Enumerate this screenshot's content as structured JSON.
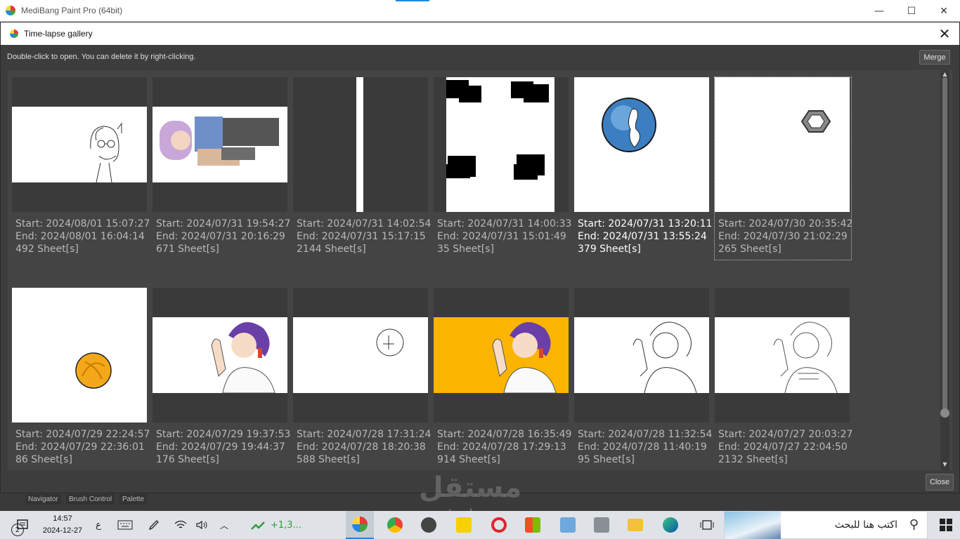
{
  "app": {
    "title": "MediBang Paint Pro (64bit)",
    "minimize_glyph": "—",
    "maximize_glyph": "☐",
    "close_glyph": "✕"
  },
  "dialog": {
    "title": "Time-lapse gallery",
    "close_glyph": "✕",
    "hint": "Double-click to open. You can delete it by right-clicking.",
    "merge_label": "Merge",
    "close_label": "Close"
  },
  "gallery": [
    {
      "start": "Start: 2024/08/01 15:07:27",
      "end": "End: 2024/08/01 16:04:14",
      "sheets": "492 Sheet[s]"
    },
    {
      "start": "Start: 2024/07/31 19:54:27",
      "end": "End: 2024/07/31 20:16:29",
      "sheets": "671 Sheet[s]"
    },
    {
      "start": "Start: 2024/07/31 14:02:54",
      "end": "End: 2024/07/31 15:17:15",
      "sheets": "2144 Sheet[s]"
    },
    {
      "start": "Start: 2024/07/31 14:00:33",
      "end": "End: 2024/07/31 15:01:49",
      "sheets": "35 Sheet[s]"
    },
    {
      "start": "Start: 2024/07/31 13:20:11",
      "end": "End: 2024/07/31 13:55:24",
      "sheets": "379 Sheet[s]"
    },
    {
      "start": "Start: 2024/07/30 20:35:42",
      "end": "End: 2024/07/30 21:02:29",
      "sheets": "265 Sheet[s]"
    },
    {
      "start": "Start: 2024/07/29 22:24:57",
      "end": "End: 2024/07/29 22:36:01",
      "sheets": "86 Sheet[s]"
    },
    {
      "start": "Start: 2024/07/29 19:37:53",
      "end": "End: 2024/07/29 19:44:37",
      "sheets": "176 Sheet[s]"
    },
    {
      "start": "Start: 2024/07/28 17:31:24",
      "end": "End: 2024/07/28 18:20:38",
      "sheets": "588 Sheet[s]"
    },
    {
      "start": "Start: 2024/07/28 16:35:49",
      "end": "End: 2024/07/28 17:29:13",
      "sheets": "914 Sheet[s]"
    },
    {
      "start": "Start: 2024/07/28 11:32:54",
      "end": "End: 2024/07/28 11:40:19",
      "sheets": "95 Sheet[s]"
    },
    {
      "start": "Start: 2024/07/27 20:03:27",
      "end": "End: 2024/07/27 22:04:50",
      "sheets": "2132 Sheet[s]"
    }
  ],
  "panels": {
    "navigator": "Navigator",
    "brush_control": "Brush Control",
    "palette": "Palette"
  },
  "taskbar": {
    "notification_count": "2",
    "time": "14:57",
    "date": "2024-12-27",
    "lang": "ع",
    "stocks": "+1,3...",
    "search_placeholder": "اكتب هنا للبحث"
  },
  "watermark": {
    "arabic": "مستقل",
    "latin": "mostaql.com"
  },
  "colors": {
    "dialog_bg": "#3d3d3d",
    "accent": "#1e88e5",
    "orange_canvas": "#fbb400"
  }
}
